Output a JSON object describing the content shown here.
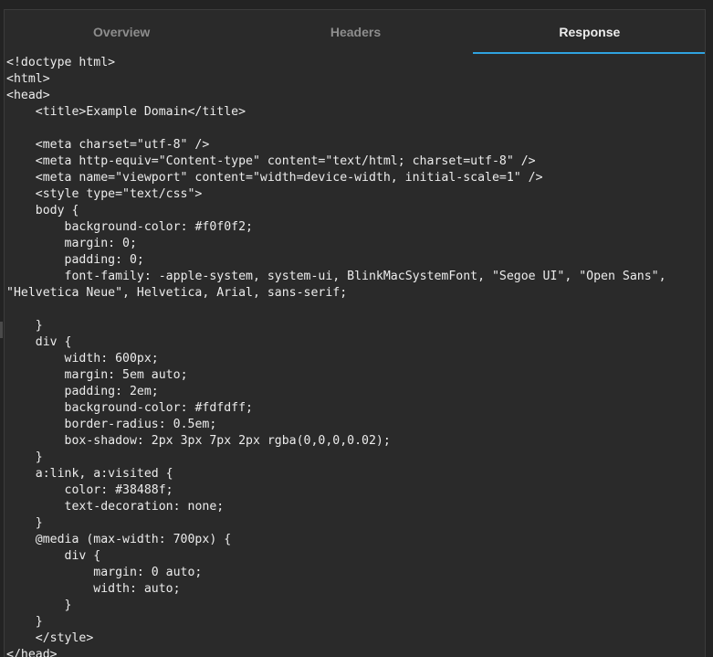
{
  "tabs": [
    {
      "label": "Overview",
      "active": false
    },
    {
      "label": "Headers",
      "active": false
    },
    {
      "label": "Response",
      "active": true
    }
  ],
  "accent_color": "#2fa3e0",
  "response_lines": [
    "<!doctype html>",
    "<html>",
    "<head>",
    "    <title>Example Domain</title>",
    "",
    "    <meta charset=\"utf-8\" />",
    "    <meta http-equiv=\"Content-type\" content=\"text/html; charset=utf-8\" />",
    "    <meta name=\"viewport\" content=\"width=device-width, initial-scale=1\" />",
    "    <style type=\"text/css\">",
    "    body {",
    "        background-color: #f0f0f2;",
    "        margin: 0;",
    "        padding: 0;",
    "        font-family: -apple-system, system-ui, BlinkMacSystemFont, \"Segoe UI\", \"Open Sans\", \"Helvetica Neue\", Helvetica, Arial, sans-serif;",
    "",
    "    }",
    "    div {",
    "        width: 600px;",
    "        margin: 5em auto;",
    "        padding: 2em;",
    "        background-color: #fdfdff;",
    "        border-radius: 0.5em;",
    "        box-shadow: 2px 3px 7px 2px rgba(0,0,0,0.02);",
    "    }",
    "    a:link, a:visited {",
    "        color: #38488f;",
    "        text-decoration: none;",
    "    }",
    "    @media (max-width: 700px) {",
    "        div {",
    "            margin: 0 auto;",
    "            width: auto;",
    "        }",
    "    }",
    "    </style>",
    "</head>"
  ]
}
